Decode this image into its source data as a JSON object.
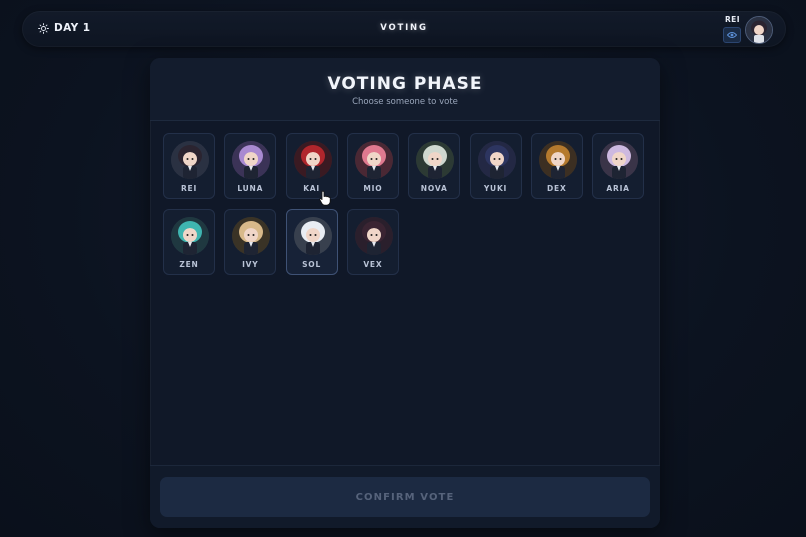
{
  "topbar": {
    "day_label": "DAY 1",
    "phase_label": "VOTING",
    "current_player": "REI"
  },
  "panel": {
    "title": "VOTING PHASE",
    "subtitle": "Choose someone to vote",
    "confirm_label": "CONFIRM VOTE"
  },
  "players": [
    {
      "name": "REI",
      "hair": "#2b2430",
      "bg": "#2a3142"
    },
    {
      "name": "LUNA",
      "hair": "#a98ad1",
      "bg": "#3b3357"
    },
    {
      "name": "KAI",
      "hair": "#b0262c",
      "bg": "#3a1a22"
    },
    {
      "name": "MIO",
      "hair": "#e0798f",
      "bg": "#4a2834"
    },
    {
      "name": "NOVA",
      "hair": "#cfd8cf",
      "bg": "#2c3a34"
    },
    {
      "name": "YUKI",
      "hair": "#2d3560",
      "bg": "#232844"
    },
    {
      "name": "DEX",
      "hair": "#b57a2e",
      "bg": "#3c2f22"
    },
    {
      "name": "ARIA",
      "hair": "#cdb9e0",
      "bg": "#3a3448"
    },
    {
      "name": "ZEN",
      "hair": "#3fb5b0",
      "bg": "#1f3840"
    },
    {
      "name": "IVY",
      "hair": "#d8b98a",
      "bg": "#3a3326"
    },
    {
      "name": "SOL",
      "hair": "#e9edf3",
      "bg": "#38404e"
    },
    {
      "name": "VEX",
      "hair": "#3a2432",
      "bg": "#2a1f2c"
    }
  ],
  "colors": {
    "background": "#0c1320",
    "panel": "#101828",
    "card": "#141e30",
    "confirm_disabled": "#1c2a42"
  }
}
